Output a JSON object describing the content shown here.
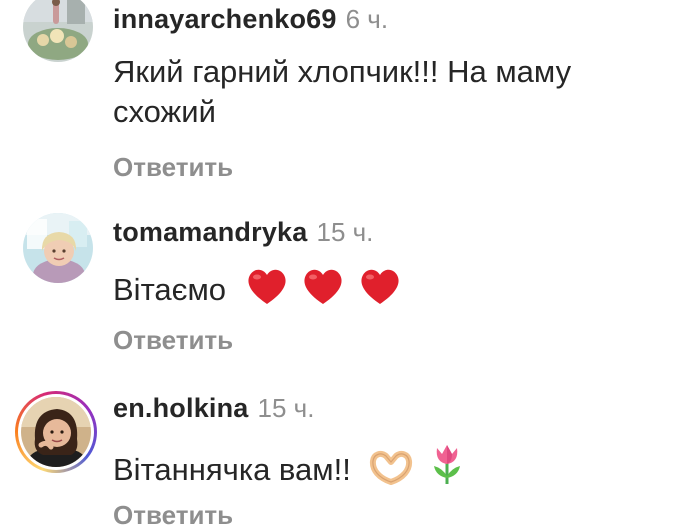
{
  "comments": [
    {
      "username": "innayarchenko69",
      "time": "6 ч.",
      "text": "Який гарний хлопчик!!! На маму схожий",
      "reply_label": "Ответить",
      "avatar": "profile-photo-flowers"
    },
    {
      "username": "tomamandryka",
      "time": "15 ч.",
      "text": "Вітаємо",
      "emojis": [
        "red-heart-icon",
        "red-heart-icon",
        "red-heart-icon"
      ],
      "reply_label": "Ответить",
      "avatar": "profile-photo-woman-blonde"
    },
    {
      "username": "en.holkina",
      "time": "15 ч.",
      "text": "Вітаннячка вам!!",
      "emojis": [
        "heart-hands-icon",
        "tulip-icon"
      ],
      "reply_label": "Ответить",
      "avatar": "profile-photo-woman-dark-hair",
      "has_story_ring": true
    }
  ],
  "colors": {
    "text": "#262626",
    "secondary": "#8e8e8e",
    "heart": "#e0202c",
    "story_ring": [
      "#feda75",
      "#fa7e1e",
      "#d62976",
      "#962fbf",
      "#4f5bd5"
    ]
  }
}
